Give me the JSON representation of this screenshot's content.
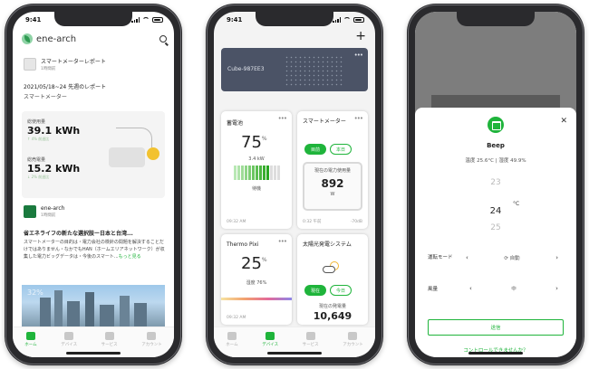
{
  "status_time": "9:41",
  "tabs": [
    "ホーム",
    "デバイス",
    "サービス",
    "アカウント"
  ],
  "screen1": {
    "app_name": "ene-arch",
    "report_item": {
      "title": "スマートメーターレポート",
      "time": "1時間前"
    },
    "report_period": "2021/05/18~24 先週のレポート",
    "report_section": "スマートメーター",
    "usage_label": "総使用量",
    "usage_value": "39.1 kWh",
    "usage_sub": "↑ 4% 前週比",
    "sold_label": "総売電量",
    "sold_value": "15.2 kWh",
    "sold_sub": "↓ 2% 前週比",
    "news_source": {
      "title": "ene-arch",
      "time": "1時間前"
    },
    "news_headline": "省エネライフの新たな選択肢ー日本と台湾...",
    "news_body": "スマートメーターの目的は・電力会社の検針の間題を解決することだけではありません・なかでもHAN（ホームエリアネットワーク）が収集した電力ビッグデータは・今後のスマート...",
    "news_more": "もっと見る",
    "news_img_label": "32%"
  },
  "screen2": {
    "cube_name": "Cube-987EE3",
    "battery": {
      "title": "蓄電池",
      "percent": "75",
      "unit": "%",
      "power": "3.4 kW",
      "status": "待機",
      "time": "09:32 AM"
    },
    "meter": {
      "title": "スマートメーター",
      "btn_now": "目前",
      "btn_today": "本日",
      "label": "現在の電力使用量",
      "value": "892",
      "unit": "W",
      "time": "0:32 午前",
      "signal": "-70dB"
    },
    "thermo": {
      "title": "Thermo Pixi",
      "percent": "25",
      "unit": "%",
      "humidity": "湿度 76%",
      "time": "09:32 AM"
    },
    "solar": {
      "title": "太陽光発電システム",
      "btn_now": "現在",
      "btn_today": "今日",
      "label": "現在の発電量",
      "value": "10,649"
    }
  },
  "screen3": {
    "device_name": "Beep",
    "climate": "温度 25.6°C  |  湿度 49.9%",
    "temps": [
      "23",
      "24",
      "25"
    ],
    "temp_unit": "°C",
    "mode_label": "運転モード",
    "mode_value": "自動",
    "fan_label": "風量",
    "fan_value": "中",
    "send_label": "送信",
    "link": "コントロールできませんか？"
  }
}
